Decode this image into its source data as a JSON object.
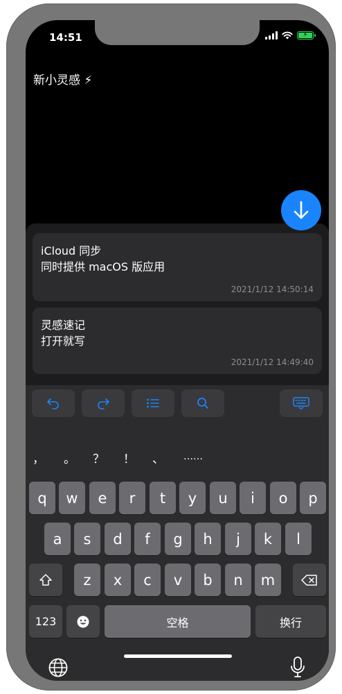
{
  "status_bar": {
    "time": "14:51"
  },
  "app": {
    "title": "新小灵感 ⚡"
  },
  "notes": [
    {
      "lines": [
        "iCloud 同步",
        "同时提供 macOS 版应用"
      ],
      "timestamp": "2021/1/12 14:50:14"
    },
    {
      "lines": [
        "灵感速记",
        "打开就写"
      ],
      "timestamp": "2021/1/12 14:49:40"
    }
  ],
  "toolbar": {
    "icons": [
      "undo-icon",
      "redo-icon",
      "list-icon",
      "search-icon",
      "keyboard-hide-icon"
    ]
  },
  "keyboard": {
    "candidates": [
      "，",
      "。",
      "？",
      "！",
      "、",
      "……"
    ],
    "row1": [
      "q",
      "w",
      "e",
      "r",
      "t",
      "y",
      "u",
      "i",
      "o",
      "p"
    ],
    "row2": [
      "a",
      "s",
      "d",
      "f",
      "g",
      "h",
      "j",
      "k",
      "l"
    ],
    "row3": [
      "z",
      "x",
      "c",
      "v",
      "b",
      "n",
      "m"
    ],
    "numbers_label": "123",
    "space_label": "空格",
    "return_label": "换行"
  },
  "colors": {
    "accent": "#1a84ff",
    "battery": "#30d158"
  }
}
